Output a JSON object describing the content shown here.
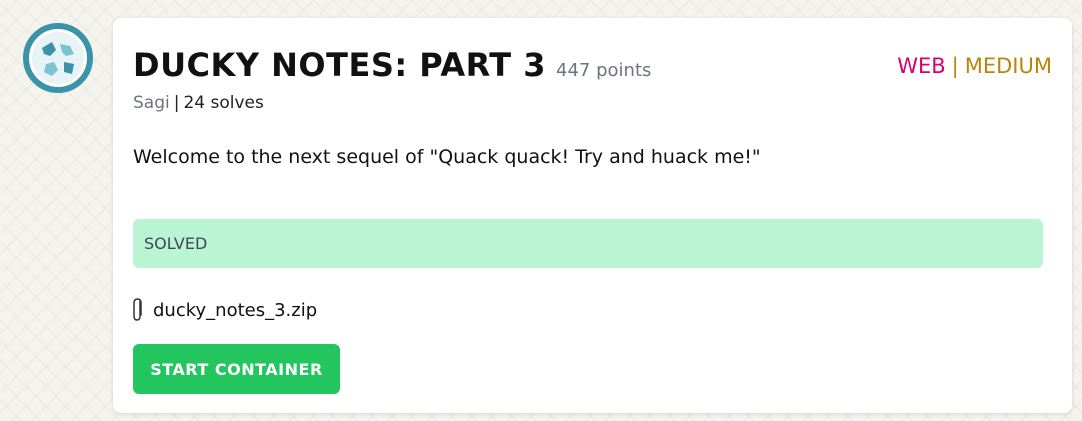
{
  "challenge": {
    "title": "DUCKY NOTES: PART 3",
    "points": "447 points",
    "author": "Sagi",
    "separator": "|",
    "solves": "24 solves",
    "category": "WEB",
    "difficulty": "MEDIUM",
    "description": "Welcome to the next sequel of \"Quack quack! Try and huack me!\"",
    "status": "SOLVED",
    "file_name": "ducky_notes_3.zip",
    "start_button_label": "START CONTAINER"
  },
  "colors": {
    "category": "#d6006f",
    "difficulty": "#b8860b",
    "solved_bg": "#b9f5d3",
    "start_button": "#22c55e",
    "avatar_teal": "#3a93a8"
  },
  "icons": {
    "avatar": "globe-avatar-icon",
    "file": "paperclip-icon"
  }
}
